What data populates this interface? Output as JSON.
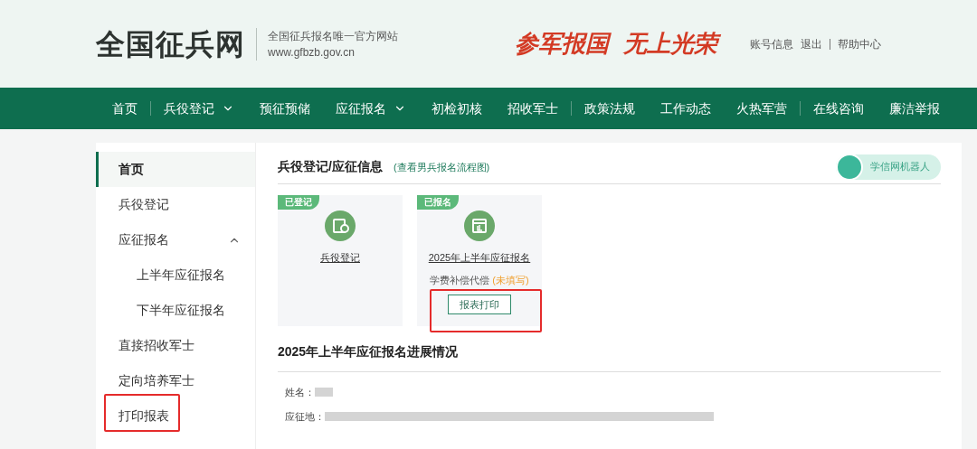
{
  "header": {
    "logo": "全国征兵网",
    "tagline": "全国征兵报名唯一官方网站",
    "url": "www.gfbzb.gov.cn",
    "slogans": [
      "参军报国",
      "无上光荣"
    ],
    "links": [
      "账号信息",
      "退出",
      "帮助中心"
    ]
  },
  "nav": [
    {
      "label": "首页",
      "dropdown": false
    },
    {
      "label": "兵役登记",
      "dropdown": true
    },
    {
      "label": "预征预储",
      "dropdown": false
    },
    {
      "label": "应征报名",
      "dropdown": true
    },
    {
      "label": "初检初核",
      "dropdown": false
    },
    {
      "label": "招收军士",
      "dropdown": false
    },
    {
      "label": "政策法规",
      "dropdown": false
    },
    {
      "label": "工作动态",
      "dropdown": false
    },
    {
      "label": "火热军营",
      "dropdown": false
    },
    {
      "label": "在线咨询",
      "dropdown": false
    },
    {
      "label": "廉洁举报",
      "dropdown": false
    }
  ],
  "sidebar": {
    "items": [
      {
        "label": "首页",
        "selected": true,
        "highlighted": false
      },
      {
        "label": "兵役登记",
        "selected": false,
        "highlighted": false
      },
      {
        "label": "应征报名",
        "selected": false,
        "highlighted": false,
        "expanded": true,
        "children": [
          {
            "label": "上半年应征报名",
            "selected": false,
            "highlighted": false
          },
          {
            "label": "下半年应征报名",
            "selected": false,
            "highlighted": false
          }
        ]
      },
      {
        "label": "直接招收军士",
        "selected": false,
        "highlighted": false
      },
      {
        "label": "定向培养军士",
        "selected": false,
        "highlighted": false
      },
      {
        "label": "打印报表",
        "selected": false,
        "highlighted": true
      }
    ]
  },
  "main": {
    "title": "兵役登记/应征信息",
    "flow_link": "(查看男兵报名流程图)",
    "robot": "学信网机器人",
    "cards": [
      {
        "badge": "已登记",
        "kind": "register",
        "link": "兵役登记"
      },
      {
        "badge": "已报名",
        "kind": "enlist",
        "link": "2025年上半年应征报名",
        "note": "学费补偿代偿",
        "note_status": "(未填写)",
        "button": "报表打印",
        "highlighted": true
      }
    ],
    "progress_title": "2025年上半年应征报名进展情况",
    "fields": [
      {
        "label": "姓名："
      },
      {
        "label": "应征地："
      }
    ]
  }
}
